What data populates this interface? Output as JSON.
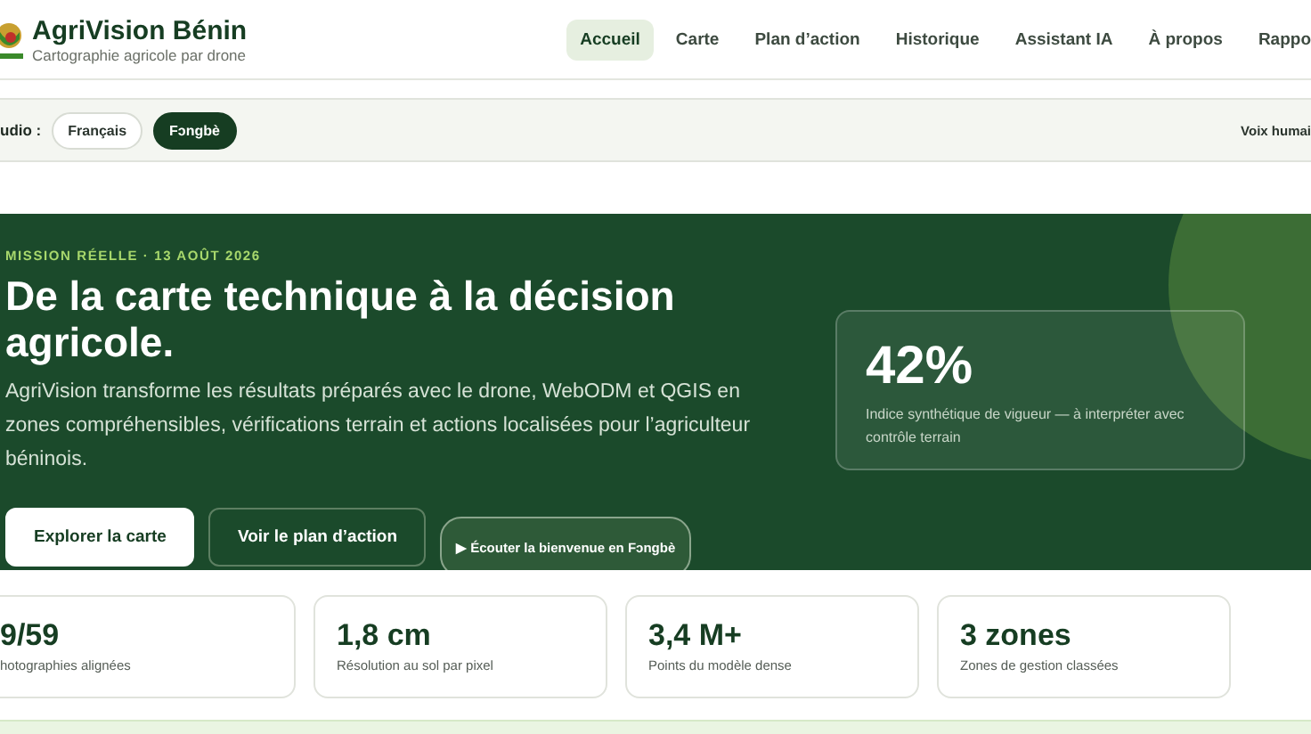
{
  "header": {
    "title": "AgriVision Bénin",
    "subtitle": "Cartographie agricole par drone"
  },
  "nav": [
    {
      "label": "Accueil",
      "selected": true
    },
    {
      "label": "Carte",
      "selected": false
    },
    {
      "label": "Plan d’action",
      "selected": false
    },
    {
      "label": "Historique",
      "selected": false
    },
    {
      "label": "Assistant IA",
      "selected": false
    },
    {
      "label": "À propos",
      "selected": false
    },
    {
      "label": "Rappo",
      "selected": false
    }
  ],
  "audio_bar": {
    "label": "udio :",
    "languages": [
      {
        "label": "Français",
        "selected": false
      },
      {
        "label": "Fɔngbè",
        "selected": true
      }
    ],
    "voice_note": "Voix humai"
  },
  "hero": {
    "eyebrow": "MISSION RÉELLE · 13 AOÛT 2026",
    "title": "De la carte technique à la décision agricole.",
    "text": "AgriVision transforme les résultats préparés avec le drone, WebODM et QGIS en zones compréhensibles, vérifications terrain et actions localisées pour l’agriculteur béninois.",
    "buttons": [
      {
        "label": "Explorer la carte",
        "kind": "primary"
      },
      {
        "label": "Voir le plan d’action",
        "kind": "outline"
      },
      {
        "label": "▶ Écouter la bienvenue en Fɔngbè",
        "kind": "audio"
      }
    ],
    "metric": {
      "value": "42%",
      "caption": "Indice synthétique de vigueur — à interpréter avec contrôle terrain"
    }
  },
  "stats": [
    {
      "value": "9/59",
      "label": "hotographies alignées"
    },
    {
      "value": "1,8 cm",
      "label": "Résolution au sol par pixel"
    },
    {
      "value": "3,4 M+",
      "label": "Points du modèle dense"
    },
    {
      "value": "3 zones",
      "label": "Zones de gestion classées"
    }
  ]
}
